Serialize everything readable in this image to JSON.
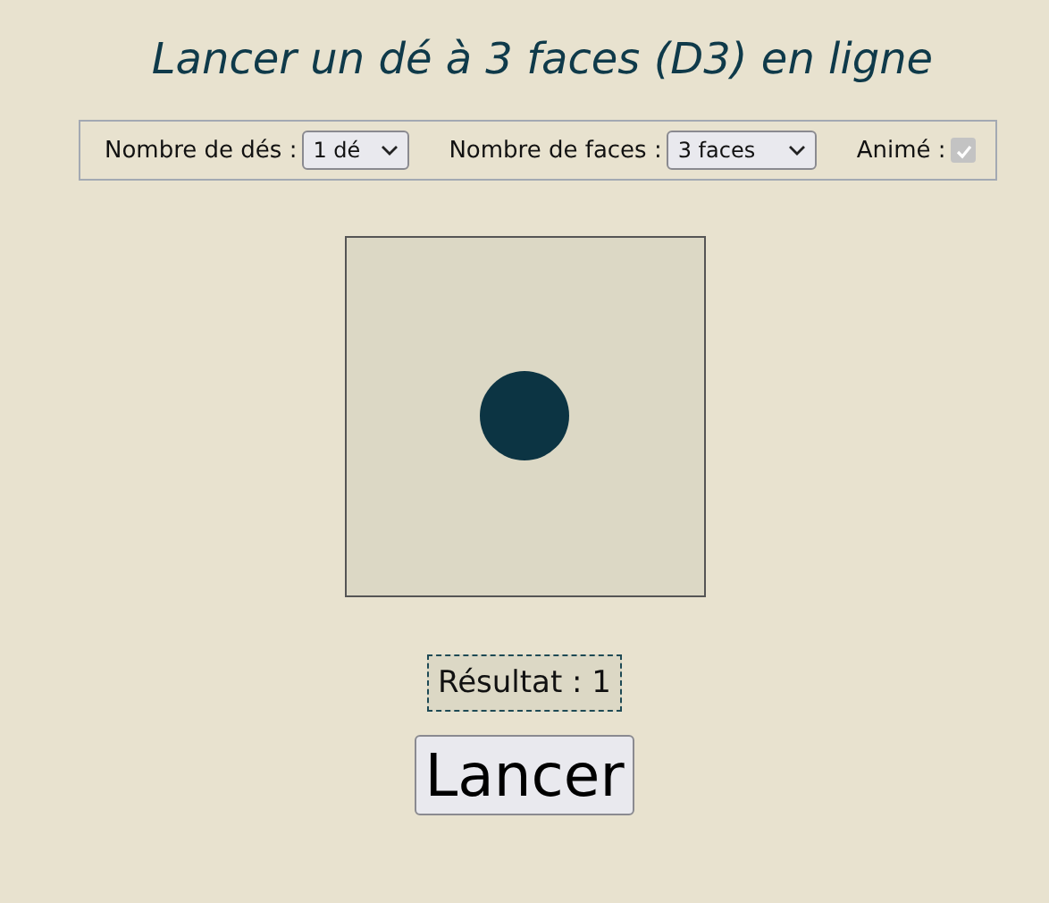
{
  "title": "Lancer un dé à 3 faces (D3) en ligne",
  "controls": {
    "dice_count": {
      "label": "Nombre de dés :",
      "value": "1 dé"
    },
    "faces": {
      "label": "Nombre de faces :",
      "value": "3 faces"
    },
    "animated": {
      "label": "Animé :",
      "checked": true,
      "disabled": true
    }
  },
  "result": "Résultat : 1",
  "button": "Lancer"
}
